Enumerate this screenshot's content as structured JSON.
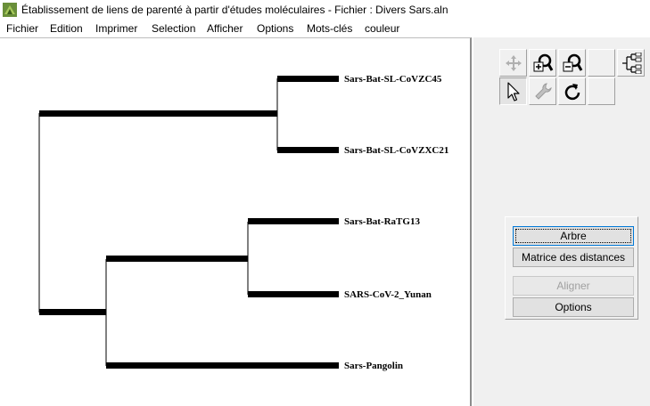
{
  "window": {
    "title": "Établissement de liens de parenté à partir d'études moléculaires - Fichier : Divers Sars.aln"
  },
  "menu": {
    "items": [
      "Fichier",
      "Edition",
      "Imprimer",
      "Selection",
      "Afficher",
      "Options",
      "Mots-clés",
      "couleur"
    ]
  },
  "tree": {
    "leaves": [
      "Sars-Bat-SL-CoVZC45",
      "Sars-Bat-SL-CoVZXC21",
      "Sars-Bat-RaTG13",
      "SARS-CoV-2_Yunan",
      "Sars-Pangolin"
    ]
  },
  "toolbar": {
    "icons": [
      "scroll-arrows-icon",
      "zoom-in-icon",
      "zoom-out-icon",
      "tree-layout-icon",
      "pointer-icon",
      "wrench-icon",
      "rotate-icon"
    ]
  },
  "buttons": {
    "arbre": "Arbre",
    "matrice": "Matrice des distances",
    "aligner": "Aligner",
    "options": "Options"
  },
  "colors": {
    "branch": "#000000",
    "panel": "#f0f0f0",
    "focus": "#0078d7"
  }
}
